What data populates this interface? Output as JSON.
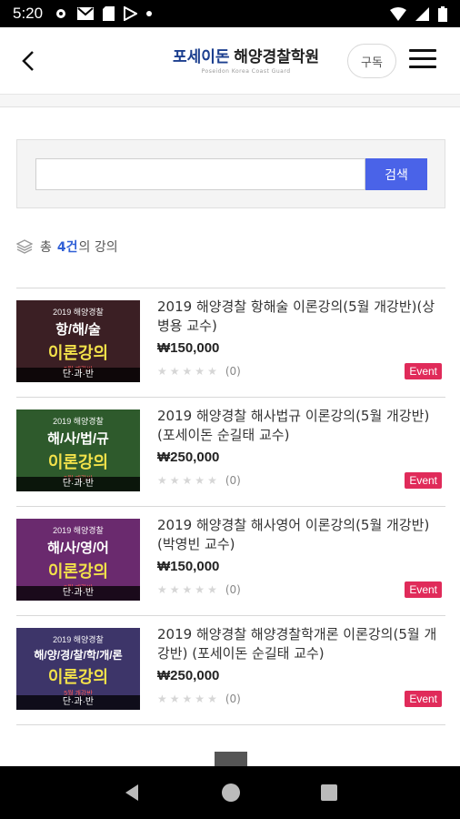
{
  "status_bar": {
    "time": "5:20"
  },
  "header": {
    "logo_blue": "포세이돈",
    "logo_dark": "해양경찰학원",
    "logo_sub": "Poseidon Korea Coast Guard",
    "subscribe_label": "구독"
  },
  "search": {
    "value": "",
    "button_label": "검색"
  },
  "summary": {
    "prefix": "총",
    "count": "4건",
    "suffix": "의 강의"
  },
  "courses": [
    {
      "title": "2019 해양경찰 항해술 이론강의(5월 개강반)(상병용 교수)",
      "price": "₩150,000",
      "rating_count": "(0)",
      "badge": "Event",
      "thumb": {
        "year": "2019 해양경찰",
        "subject": "항/해/술",
        "main": "이론강의",
        "sub": "5월 개강반",
        "foot": "단·과·반",
        "color": "#3b1f24"
      }
    },
    {
      "title": "2019 해양경찰 해사법규 이론강의(5월 개강반)(포세이돈 순길태 교수)",
      "price": "₩250,000",
      "rating_count": "(0)",
      "badge": "Event",
      "thumb": {
        "year": "2019 해양경찰",
        "subject": "해/사/법/규",
        "main": "이론강의",
        "sub": "5월 개강반",
        "foot": "단·과·반",
        "color": "#2e5a2c"
      }
    },
    {
      "title": "2019 해양경찰 해사영어 이론강의(5월 개강반)(박영빈 교수)",
      "price": "₩150,000",
      "rating_count": "(0)",
      "badge": "Event",
      "thumb": {
        "year": "2019 해양경찰",
        "subject": "해/사/영/어",
        "main": "이론강의",
        "sub": "5월 개강반",
        "foot": "단·과·반",
        "color": "#6a2a6e"
      }
    },
    {
      "title": "2019 해양경찰 해양경찰학개론 이론강의(5월 개강반) (포세이돈 순길태 교수)",
      "price": "₩250,000",
      "rating_count": "(0)",
      "badge": "Event",
      "thumb": {
        "year": "2019 해양경찰",
        "subject": "해/양/경/찰/학/개/론",
        "main": "이론강의",
        "sub": "5월 개강반",
        "foot": "단·과·반",
        "color": "#3d3569"
      }
    }
  ]
}
